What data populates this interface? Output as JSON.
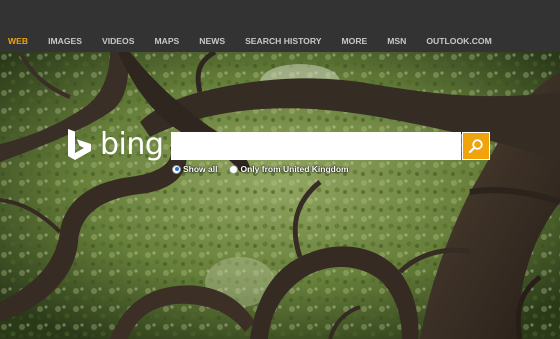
{
  "nav": {
    "items": [
      {
        "label": "WEB",
        "active": true
      },
      {
        "label": "IMAGES",
        "active": false
      },
      {
        "label": "VIDEOS",
        "active": false
      },
      {
        "label": "MAPS",
        "active": false
      },
      {
        "label": "NEWS",
        "active": false
      },
      {
        "label": "SEARCH HISTORY",
        "active": false
      },
      {
        "label": "MORE",
        "active": false
      },
      {
        "label": "MSN",
        "active": false
      },
      {
        "label": "OUTLOOK.COM",
        "active": false
      }
    ]
  },
  "logo": {
    "text": "bing",
    "icon": "bing-b-icon"
  },
  "search": {
    "value": "",
    "placeholder": "",
    "button_icon": "magnifier-icon"
  },
  "scope": {
    "options": [
      {
        "label": "Show all",
        "selected": true
      },
      {
        "label": "Only from United Kingdom",
        "selected": false
      }
    ]
  },
  "colors": {
    "topbar": "#333333",
    "nav_text": "#c8c8c8",
    "nav_active": "#f0a30a",
    "search_button": "#f0a30a"
  },
  "background": {
    "subject": "oak-tree-canopy-photo"
  }
}
